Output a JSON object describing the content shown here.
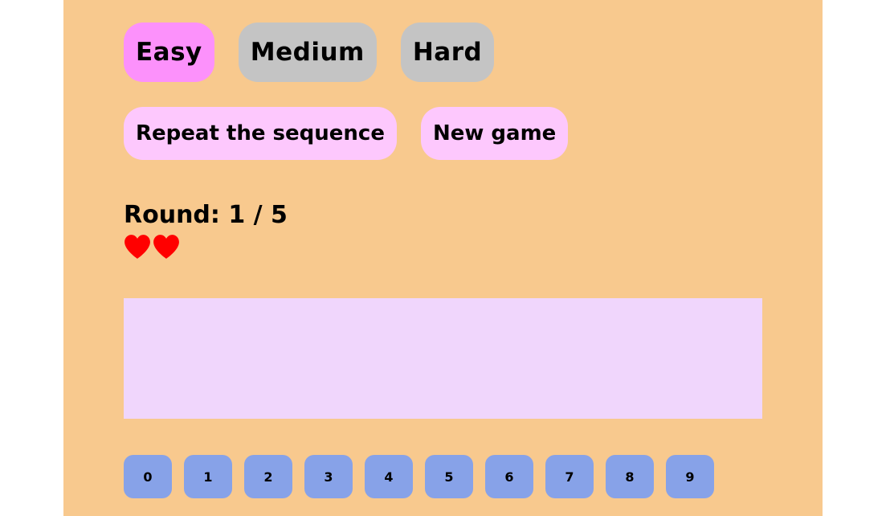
{
  "difficulty": {
    "buttons": [
      {
        "label": "Easy",
        "active": true
      },
      {
        "label": "Medium",
        "active": false
      },
      {
        "label": "Hard",
        "active": false
      }
    ]
  },
  "actions": {
    "repeat_label": "Repeat the sequence",
    "new_game_label": "New game"
  },
  "status": {
    "round_label": "Round: 1 / 5",
    "round_current": 1,
    "round_total": 5,
    "lives": 2
  },
  "sequence_display": {
    "text": ""
  },
  "keypad": {
    "digits": [
      "0",
      "1",
      "2",
      "3",
      "4",
      "5",
      "6",
      "7",
      "8",
      "9"
    ]
  },
  "colors": {
    "background": "#f8c98e",
    "active_difficulty": "#fc91fb",
    "inactive_difficulty": "#c4c4c4",
    "action_button": "#fdc8fd",
    "display_area": "#f0d6fc",
    "digit_button": "#87a2e8",
    "heart": "#ff0000"
  }
}
